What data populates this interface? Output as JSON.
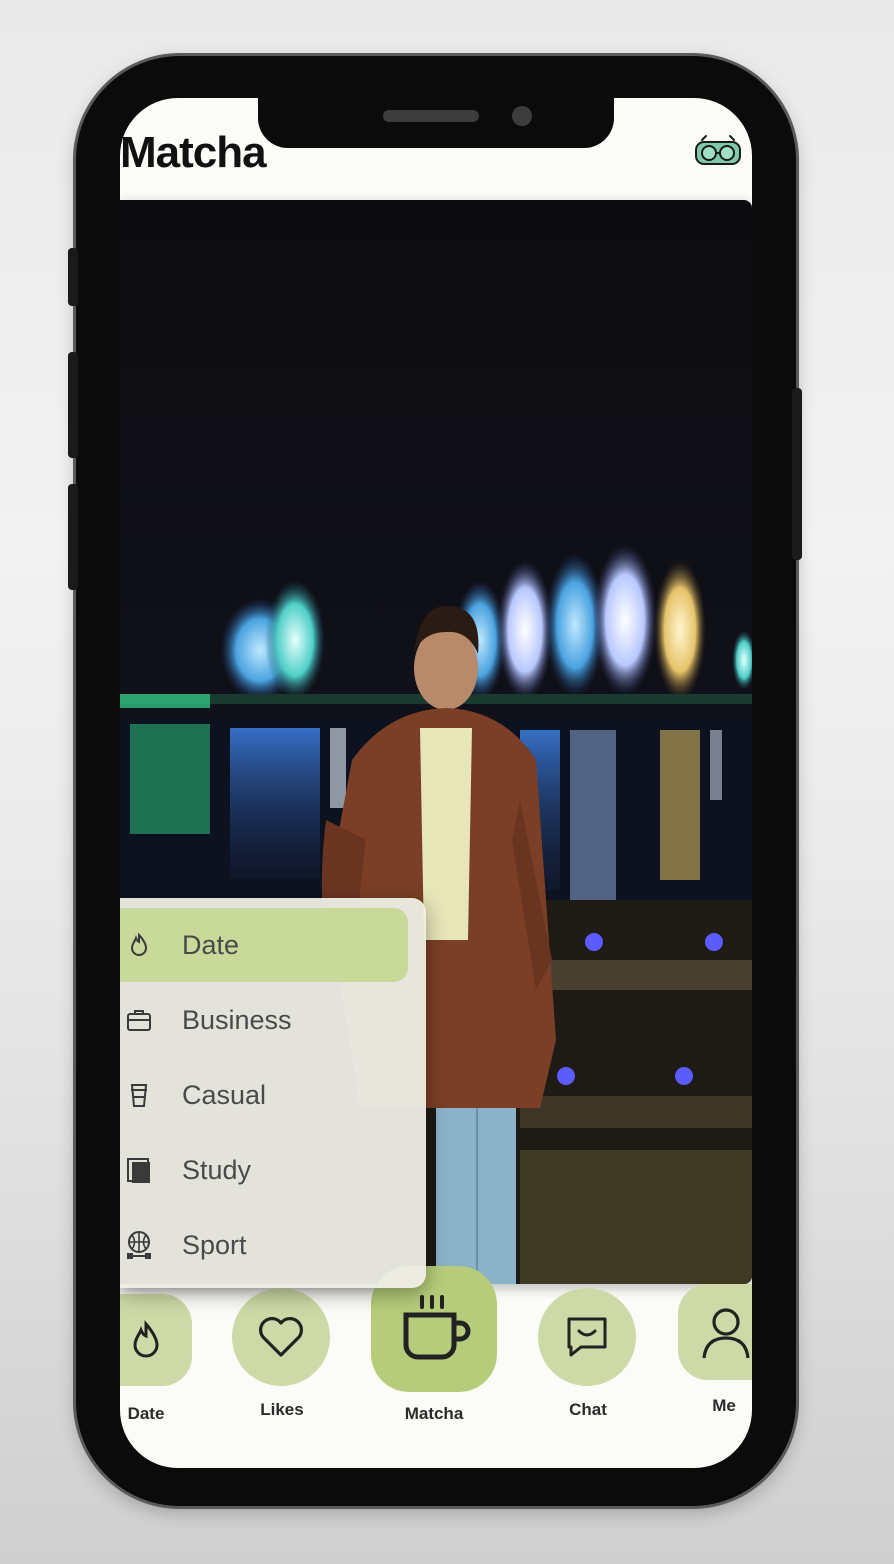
{
  "app": {
    "title": "Matcha"
  },
  "header": {
    "logo_icon": "matcha-logo-icon"
  },
  "photo": {
    "subject": "profile-photo"
  },
  "mode_menu": {
    "selected": "Date",
    "items": [
      {
        "label": "Date",
        "icon": "drop-icon"
      },
      {
        "label": "Business",
        "icon": "briefcase-icon"
      },
      {
        "label": "Casual",
        "icon": "cup-icon"
      },
      {
        "label": "Study",
        "icon": "book-icon"
      },
      {
        "label": "Sport",
        "icon": "basketball-icon"
      }
    ]
  },
  "bottom_nav": {
    "items": [
      {
        "label": "Date",
        "icon": "drop-icon"
      },
      {
        "label": "Likes",
        "icon": "heart-icon"
      },
      {
        "label": "Matcha",
        "icon": "tea-cup-icon"
      },
      {
        "label": "Chat",
        "icon": "chat-icon"
      },
      {
        "label": "Me",
        "icon": "person-icon"
      }
    ]
  },
  "colors": {
    "accent": "#b7cc7a",
    "accent_light": "#cdd9a6",
    "selected": "#c9d99a",
    "text": "#111111"
  }
}
